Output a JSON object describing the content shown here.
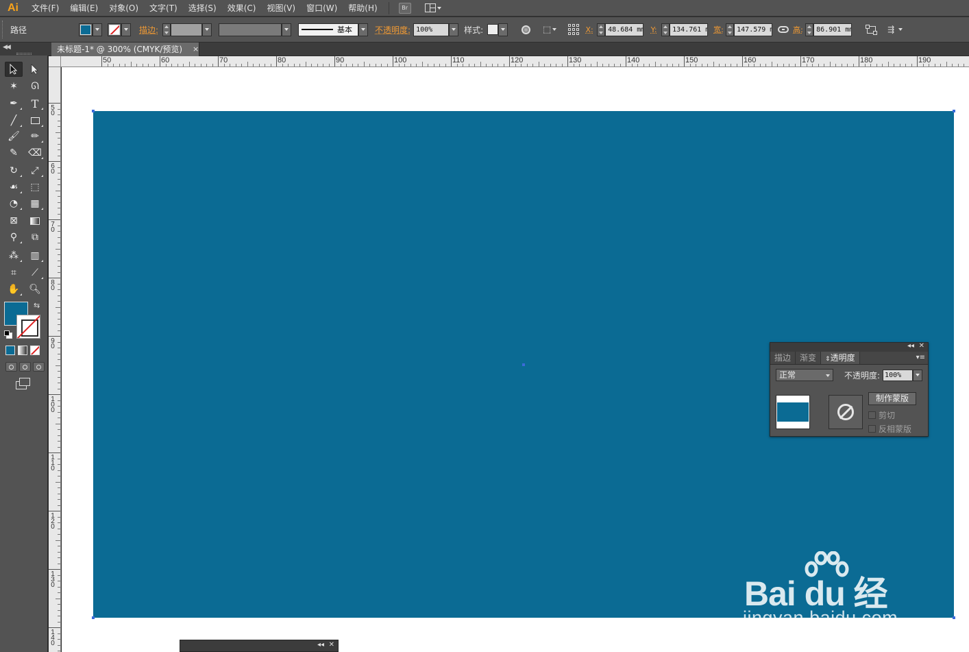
{
  "app": {
    "logo": "Ai"
  },
  "menu": [
    "文件(F)",
    "编辑(E)",
    "对象(O)",
    "文字(T)",
    "选择(S)",
    "效果(C)",
    "视图(V)",
    "窗口(W)",
    "帮助(H)"
  ],
  "menu_br": "Br",
  "control": {
    "object_type": "路径",
    "stroke_label": "描边:",
    "stroke_style": "基本",
    "opacity_label": "不透明度:",
    "opacity_value": "100%",
    "style_label": "样式:",
    "x_label": "X:",
    "x_value": "48.684 mm",
    "y_label": "Y:",
    "y_value": "134.761 mm",
    "w_label": "宽:",
    "w_value": "147.579 mm",
    "h_label": "高:",
    "h_value": "86.901 mm"
  },
  "document": {
    "tab_title": "未标题-1* @ 300% (CMYK/预览)",
    "close": "×"
  },
  "ruler": {
    "top": [
      "50",
      "60",
      "70",
      "80",
      "90",
      "100",
      "110",
      "120",
      "130",
      "140",
      "150",
      "160",
      "170",
      "180",
      "190"
    ],
    "left": [
      "50",
      "60",
      "70",
      "80",
      "90",
      "100",
      "110",
      "120",
      "130",
      "140"
    ]
  },
  "colors": {
    "fill": "#0b6b94",
    "accent_orange": "#f09a34",
    "ui_bg": "#535353",
    "canvas": "#ffffff",
    "selection": "#3b6bd9"
  },
  "transparency_panel": {
    "tabs": [
      "描边",
      "渐变",
      "透明度"
    ],
    "active_tab": "透明度",
    "blend_mode": "正常",
    "opacity_label": "不透明度:",
    "opacity_value": "100%",
    "make_mask": "制作蒙版",
    "clip": "剪切",
    "invert_mask": "反相蒙版"
  },
  "watermark": {
    "brand": "Bai du 经验",
    "url": "jingyan.baidu.com"
  }
}
